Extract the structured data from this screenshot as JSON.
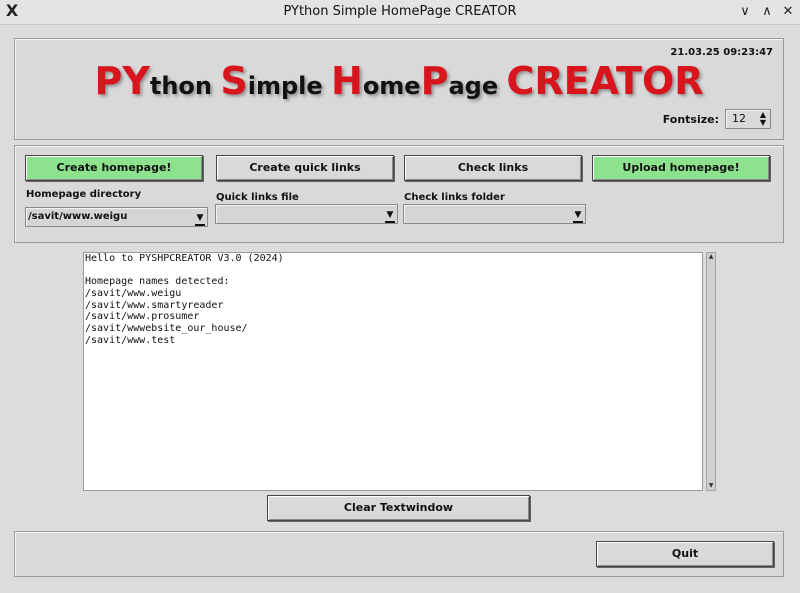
{
  "window": {
    "title": "PYthon Simple HomePage CREATOR",
    "app_icon_glyph": "X",
    "min_glyph": "∨",
    "max_glyph": "∧",
    "close_glyph": "✕"
  },
  "header": {
    "datetime": "21.03.25 09:23:47",
    "banner": [
      {
        "text": "PY",
        "style": "red"
      },
      {
        "text": "thon ",
        "style": "dark"
      },
      {
        "text": "S",
        "style": "red"
      },
      {
        "text": "imple ",
        "style": "dark"
      },
      {
        "text": "H",
        "style": "red"
      },
      {
        "text": "ome",
        "style": "dark"
      },
      {
        "text": "P",
        "style": "red"
      },
      {
        "text": "age ",
        "style": "dark"
      },
      {
        "text": "CREATOR",
        "style": "red"
      }
    ],
    "fontsize_label": "Fontsize:",
    "fontsize_value": "12",
    "spin_up_glyph": "▲",
    "spin_down_glyph": "▼"
  },
  "controls": {
    "create_homepage": "Create homepage!",
    "create_quick_links": "Create quick links",
    "check_links": "Check links",
    "upload_homepage": "Upload homepage!",
    "homepage_dir_label": "Homepage directory",
    "homepage_dir_value": "/savit/www.weigu",
    "quick_links_label": "Quick links file",
    "quick_links_value": "",
    "check_folder_label": "Check links folder",
    "check_folder_value": "",
    "combo_arrow_glyph": "▼"
  },
  "textwindow": {
    "lines": [
      "Hello to PYSHPCREATOR V3.0 (2024)",
      "",
      "Homepage names detected:",
      "/savit/www.weigu",
      "/savit/www.smartyreader",
      "/savit/www.prosumer",
      "/savit/wwwebsite_our_house/",
      "/savit/www.test"
    ],
    "scroll_up_glyph": "▲",
    "scroll_down_glyph": "▼"
  },
  "bottom": {
    "clear_textwindow": "Clear Textwindow",
    "quit": "Quit"
  },
  "colors": {
    "brand_red": "#d8141d",
    "button_green": "#8de38d",
    "panel_bg": "#d9d9d9"
  }
}
